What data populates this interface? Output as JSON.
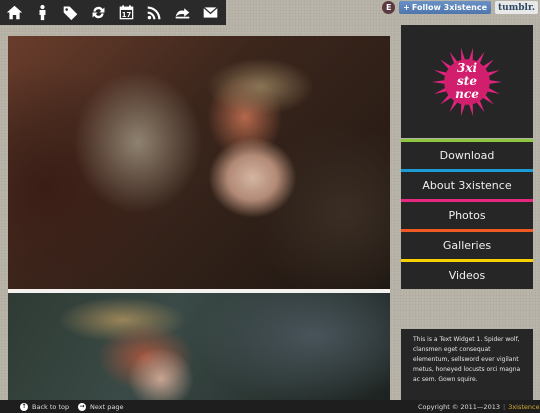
{
  "topbar": {
    "icons": [
      {
        "name": "home-icon"
      },
      {
        "name": "person-icon"
      },
      {
        "name": "tags-icon"
      },
      {
        "name": "reblog-icon"
      },
      {
        "name": "calendar-icon",
        "label": "17"
      },
      {
        "name": "rss-icon"
      },
      {
        "name": "ask-icon"
      },
      {
        "name": "mail-icon"
      }
    ]
  },
  "tumblr_controls": {
    "dashboard_label": "E",
    "follow_label": "Follow 3xistence",
    "brand_label": "tumblr."
  },
  "logo": {
    "line1": "3xi",
    "line2": "ste",
    "line3": "nce"
  },
  "nav": {
    "items": [
      {
        "label": "Download",
        "color": "#8dc63f"
      },
      {
        "label": "About 3xistence",
        "color": "#1c9ad6"
      },
      {
        "label": "Photos",
        "color": "#e62880"
      },
      {
        "label": "Galleries",
        "color": "#ef5a24"
      },
      {
        "label": "Videos",
        "color": "#f6d000"
      }
    ]
  },
  "widget": {
    "text": "This is a Text Widget 1. Spider wolf, clansmen eget consequat elementum, sellsword ever vigilant metus, honeyed locusts orci magna ac sem. Gown squire."
  },
  "footer": {
    "back_to_top": "Back to top",
    "next_page": "Next page",
    "copyright": "Copyright © 2011—2013",
    "site_name": "3xistence"
  },
  "colors": {
    "bar_background": "#2a2a2a",
    "logo_magenta": "#e0237e",
    "site_name_color": "#d6aa2c"
  }
}
